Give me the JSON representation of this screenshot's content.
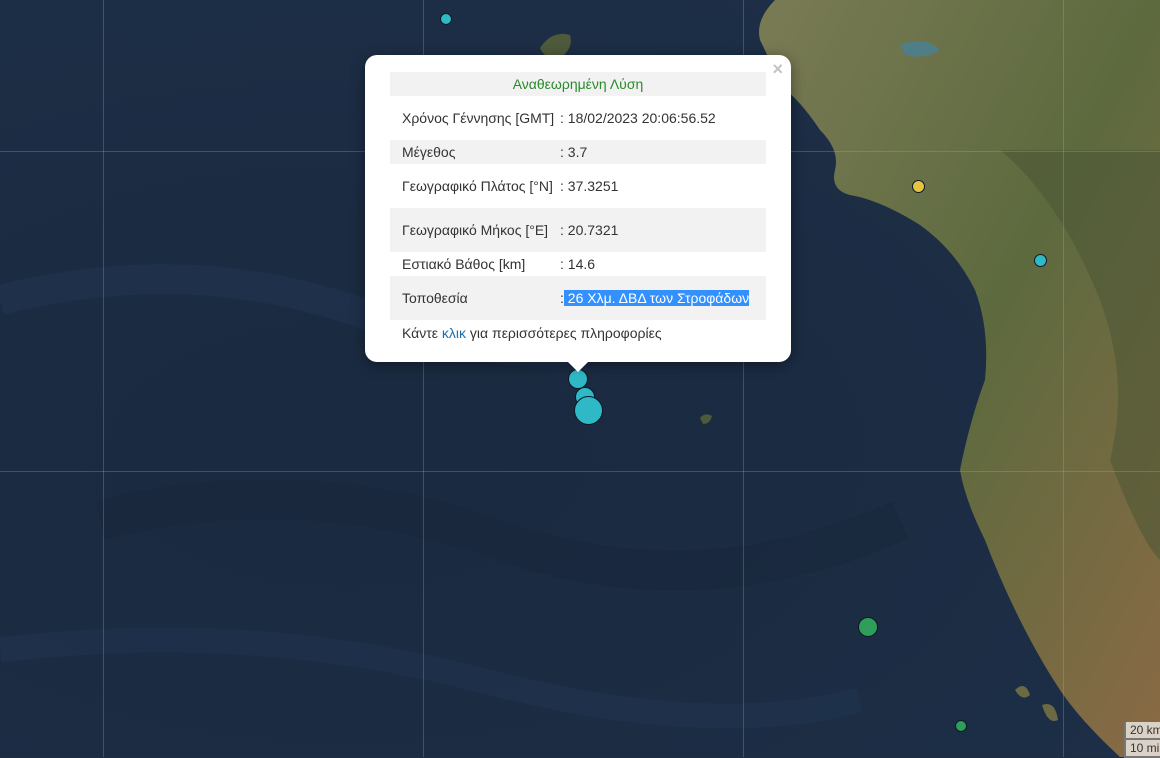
{
  "popup": {
    "title": "Αναθεωρημένη Λύση",
    "close_glyph": "×",
    "rows": [
      {
        "label": "Χρόνος Γέννησης [GMT]",
        "value": ": 18/02/2023 20:06:56.52"
      },
      {
        "label": "Μέγεθος",
        "value": ": 3.7"
      },
      {
        "label": "Γεωγραφικό Πλάτος [°N]",
        "value": ": 37.3251"
      },
      {
        "label": "Γεωγραφικό Μήκος [°E]",
        "value": ": 20.7321"
      },
      {
        "label": "Εστιακό Βάθος [km]",
        "value": ": 14.6"
      },
      {
        "label": "Τοποθεσία",
        "value_prefix": ":",
        "value_selected": " 26 Χλμ. ΔΒΔ των Στροφάδων"
      }
    ],
    "footer_before": "Κάντε ",
    "footer_link": "κλικ",
    "footer_after": " για περισσότερες πληροφορίες"
  },
  "scale": {
    "upper": "20 km",
    "lower": "10 mi"
  },
  "colors": {
    "sea": "#1b2c43",
    "land": "#6b7046",
    "marker_cyan": "#2fb8c6",
    "marker_yellow": "#e6c341",
    "marker_green": "#2e9e5a",
    "popup_title": "#2a8a2a",
    "selection": "#3390ff",
    "link": "#1a6fb0"
  },
  "markers": [
    {
      "name": "cyan",
      "color": "#2fb8c6"
    },
    {
      "name": "cyan",
      "color": "#2fb8c6"
    },
    {
      "name": "cyan",
      "color": "#2fb8c6"
    },
    {
      "name": "cyan",
      "color": "#2fb8c6"
    },
    {
      "name": "cyan",
      "color": "#2fb8c6"
    },
    {
      "name": "yellow",
      "color": "#e6c341"
    },
    {
      "name": "green",
      "color": "#2e9e5a"
    },
    {
      "name": "green",
      "color": "#2e9e5a"
    }
  ]
}
